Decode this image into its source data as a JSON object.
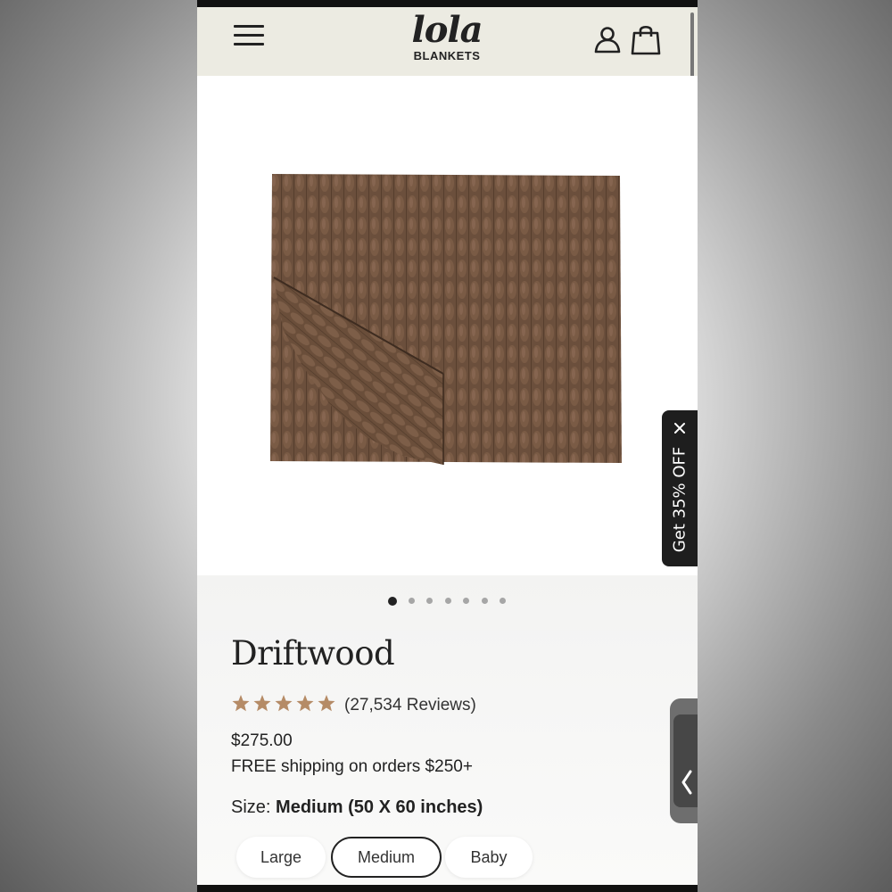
{
  "header": {
    "logo_script": "lola",
    "logo_sub": "BLANKETS",
    "menu_icon": "hamburger-menu-icon",
    "account_icon": "user-icon",
    "cart_icon": "shopping-bag-icon"
  },
  "gallery": {
    "image_count": 7,
    "active_index": 0,
    "image_alt": "Driftwood blanket"
  },
  "product": {
    "title": "Driftwood",
    "rating": 5,
    "reviews_text": "(27,534 Reviews)",
    "price": "$275.00",
    "shipping": "FREE shipping on orders $250+",
    "size_label": "Size:",
    "size_value": "Medium (50 X 60 inches)",
    "sizes": [
      {
        "label": "Large",
        "selected": false
      },
      {
        "label": "Medium",
        "selected": true
      },
      {
        "label": "Baby",
        "selected": false
      }
    ]
  },
  "promo": {
    "label": "Get 35% OFF",
    "close_icon": "close-icon"
  },
  "side_widget": {
    "icon": "chevron-left-icon"
  },
  "colors": {
    "header_bg": "#ecebe2",
    "star": "#b58b66",
    "blanket": "#6b4f3c",
    "promo_bg": "#1e1e1e"
  }
}
